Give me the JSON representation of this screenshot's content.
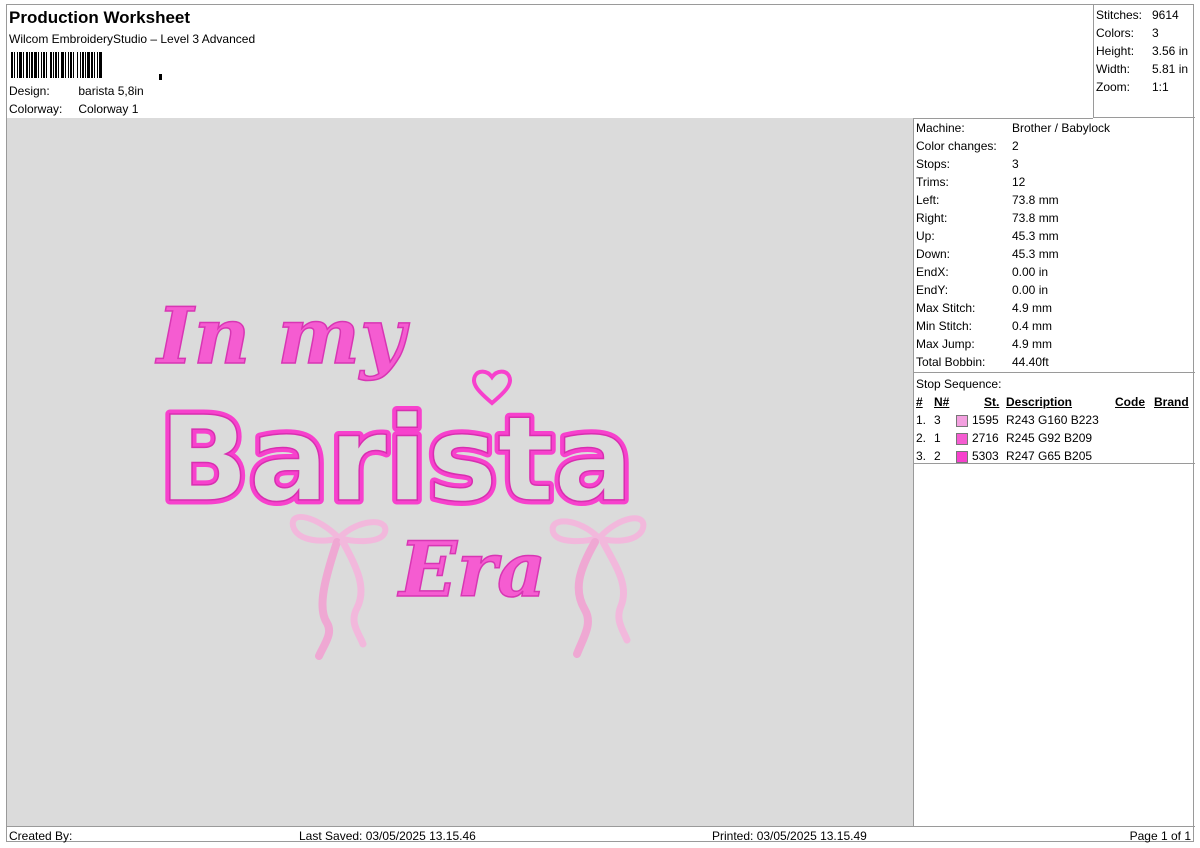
{
  "header": {
    "title": "Production Worksheet",
    "software": "Wilcom EmbroideryStudio – Level 3 Advanced",
    "design_label": "Design:",
    "design_value": "barista 5,8in",
    "colorway_label": "Colorway:",
    "colorway_value": "Colorway 1"
  },
  "stats": {
    "stitches_label": "Stitches:",
    "stitches": "9614",
    "colors_label": "Colors:",
    "colors": "3",
    "height_label": "Height:",
    "height": "3.56 in",
    "width_label": "Width:",
    "width": "5.81 in",
    "zoom_label": "Zoom:",
    "zoom": "1:1"
  },
  "info": [
    {
      "label": "Machine:",
      "value": "Brother / Babylock"
    },
    {
      "label": "Color changes:",
      "value": "2"
    },
    {
      "label": "Stops:",
      "value": "3"
    },
    {
      "label": "Trims:",
      "value": "12"
    },
    {
      "label": "Left:",
      "value": "73.8 mm"
    },
    {
      "label": "Right:",
      "value": "73.8 mm"
    },
    {
      "label": "Up:",
      "value": "45.3 mm"
    },
    {
      "label": "Down:",
      "value": "45.3 mm"
    },
    {
      "label": "EndX:",
      "value": "0.00 in"
    },
    {
      "label": "EndY:",
      "value": "0.00 in"
    },
    {
      "label": "Max Stitch:",
      "value": "4.9 mm"
    },
    {
      "label": "Min Stitch:",
      "value": "0.4 mm"
    },
    {
      "label": "Max Jump:",
      "value": "4.9 mm"
    },
    {
      "label": "Total Bobbin:",
      "value": "44.40ft"
    }
  ],
  "stop_sequence": {
    "title": "Stop Sequence:",
    "headers": {
      "num": "#",
      "n": "N#",
      "st": "St.",
      "desc": "Description",
      "code": "Code",
      "brand": "Brand"
    },
    "rows": [
      {
        "num": "1.",
        "n": "3",
        "color": "#f3a0df",
        "st": "1595",
        "desc": "R243 G160 B223"
      },
      {
        "num": "2.",
        "n": "1",
        "color": "#f55cd1",
        "st": "2716",
        "desc": "R245 G92 B209"
      },
      {
        "num": "3.",
        "n": "2",
        "color": "#f741cd",
        "st": "5303",
        "desc": "R247 G65 B205"
      }
    ]
  },
  "design": {
    "line1": "In my",
    "line2": "Barista",
    "line3": "Era",
    "colors": {
      "light": "#f3a0df",
      "mid": "#f55cd1",
      "dark": "#f741cd",
      "pink_soft": "#f2b8dc",
      "canvas": "#dbdbdb"
    },
    "icons": [
      "heart-icon",
      "bow-icon"
    ]
  },
  "footer": {
    "created_by": "Created By:",
    "last_saved": "Last Saved: 03/05/2025 13.15.46",
    "printed": "Printed: 03/05/2025 13.15.49",
    "page": "Page 1 of 1"
  }
}
